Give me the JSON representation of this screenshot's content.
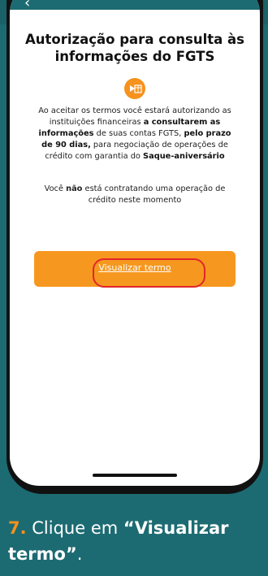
{
  "topbar": {
    "back_icon": "‹"
  },
  "title": "Autorização para consulta às informações do FGTS",
  "icon": {
    "name": "fgts-consult-icon",
    "color": "#f6921e"
  },
  "description": {
    "p1": "Ao aceitar os termos você estará autorizando as instituições financeiras ",
    "b1": "a consultarem as informações",
    "p2": " de suas contas FGTS, ",
    "b2": "pelo prazo de 90 dias,",
    "p3": " para negociação de operações de crédito com garantia do ",
    "b3": "Saque-aniversário"
  },
  "note": {
    "p1": "Você ",
    "b1": "não",
    "p2": " está contratando uma operação de crédito neste momento"
  },
  "button": {
    "label": "Visualizar termo",
    "color": "#f6981f"
  },
  "caption": {
    "number": "7.",
    "text1": " Clique em ",
    "strong": "“Visualizar termo”",
    "text2": "."
  },
  "colors": {
    "background": "#1d6b72",
    "accent": "#f6921e",
    "highlight": "#e0262b"
  }
}
